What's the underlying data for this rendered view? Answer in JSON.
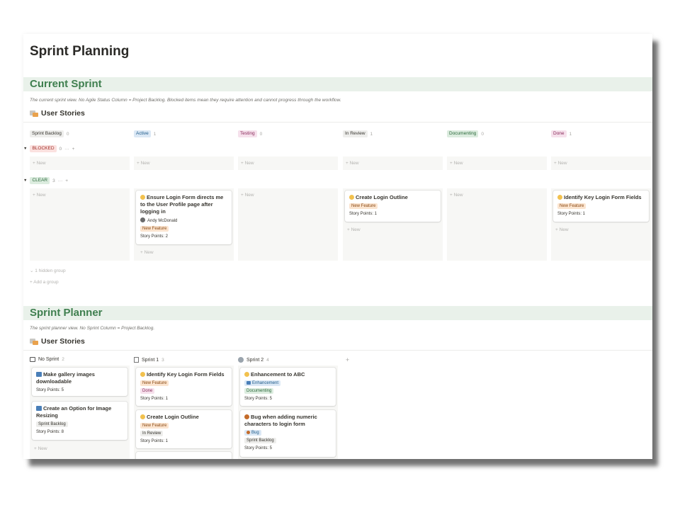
{
  "page": {
    "title": "Sprint Planning"
  },
  "current_sprint": {
    "title": "Current Sprint",
    "description": "The current sprint view. No Agile Status Column = Project Backlog. Blocked items mean they require attention and cannot progress through the workflow.",
    "db_title": "User Stories",
    "columns": [
      {
        "label": "Sprint Backlog",
        "count": "0",
        "bg": "#eeeeec",
        "fg": "#37352f"
      },
      {
        "label": "Active",
        "count": "1",
        "bg": "#dbe8f5",
        "fg": "#1f5b8a"
      },
      {
        "label": "Testing",
        "count": "0",
        "bg": "#f6e1ec",
        "fg": "#8a2d5d"
      },
      {
        "label": "In Review",
        "count": "1",
        "bg": "#eeeeec",
        "fg": "#37352f"
      },
      {
        "label": "Documenting",
        "count": "0",
        "bg": "#dcecdf",
        "fg": "#2c6a3c"
      },
      {
        "label": "Done",
        "count": "1",
        "bg": "#f6e1ec",
        "fg": "#8a2d5d"
      }
    ],
    "groups": {
      "blocked": {
        "label": "BLOCKED",
        "count": "0",
        "more": "···",
        "add": "+"
      },
      "clear": {
        "label": "CLEAR",
        "count": "3",
        "more": "···",
        "add": "+"
      }
    },
    "new_label": "+ New",
    "cards": {
      "active": {
        "title": "Ensure Login Form directs me to the User Profile page after logging in",
        "assignee": "Andy McDonald",
        "tag": "New Feature",
        "points": "Story Points: 2"
      },
      "in_review": {
        "title": "Create Login Outline",
        "tag": "New Feature",
        "points": "Story Points: 1"
      },
      "done": {
        "title": "Identify Key Login Form Fields",
        "tag": "New Feature",
        "points": "Story Points: 1"
      }
    },
    "hidden_groups": "1 hidden group",
    "add_group": "+ Add a group"
  },
  "sprint_planner": {
    "title": "Sprint Planner",
    "description": "The sprint planner view. No Sprint Column = Project Backlog.",
    "db_title": "User Stories",
    "columns": [
      {
        "label": "No Sprint",
        "count": "2"
      },
      {
        "label": "Sprint 1",
        "count": "3"
      },
      {
        "label": "Sprint 2",
        "count": "4"
      }
    ],
    "add_column": "+",
    "no_sprint_cards": [
      {
        "title": "Make gallery images downloadable",
        "points": "Story Points: 5"
      },
      {
        "title": "Create an Option for Image Resizing",
        "status": "Sprint Backlog",
        "points": "Story Points: 8"
      }
    ],
    "sprint1_cards": [
      {
        "title": "Identify Key Login Form Fields",
        "tag": "New Feature",
        "status": "Done",
        "points": "Story Points: 1"
      },
      {
        "title": "Create Login Outline",
        "tag": "New Feature",
        "status": "In Review",
        "points": "Story Points: 1"
      }
    ],
    "sprint2_cards": [
      {
        "title": "Enhancement to ABC",
        "tag": "Enhancement",
        "status": "Documenting",
        "points": "Story Points: 5"
      },
      {
        "title": "Bug when adding numeric characters to login form",
        "tag": "Bug",
        "status": "Sprint Backlog",
        "points": "Story Points: 5"
      }
    ],
    "new_label": "+ New"
  },
  "colors": {
    "section_band": "#e9f1ea",
    "section_title": "#3f7f4f",
    "new_feature_bg": "#fbe4cf",
    "new_feature_fg": "#8a4b16",
    "blocked_bg": "#fbe1df",
    "blocked_fg": "#a1302a",
    "clear_bg": "#dcecdf",
    "clear_fg": "#2c6a3c"
  }
}
